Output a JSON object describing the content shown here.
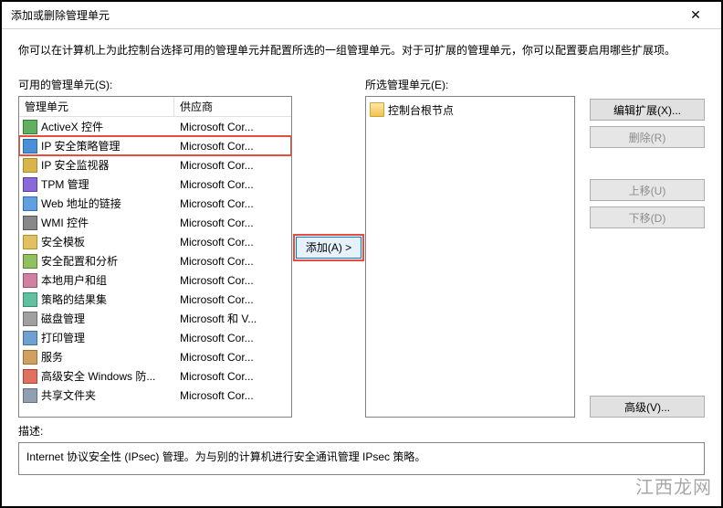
{
  "window": {
    "title": "添加或删除管理单元",
    "close_glyph": "✕"
  },
  "instructions": "你可以在计算机上为此控制台选择可用的管理单元并配置所选的一组管理单元。对于可扩展的管理单元，你可以配置要启用哪些扩展项。",
  "available": {
    "label": "可用的管理单元(S):",
    "columns": {
      "name": "管理单元",
      "vendor": "供应商"
    },
    "items": [
      {
        "name": "ActiveX 控件",
        "vendor": "Microsoft Cor...",
        "icon": "ico-activex",
        "selected": false
      },
      {
        "name": "IP 安全策略管理",
        "vendor": "Microsoft Cor...",
        "icon": "ico-ip",
        "selected": true
      },
      {
        "name": "IP 安全监视器",
        "vendor": "Microsoft Cor...",
        "icon": "ico-monitor",
        "selected": false
      },
      {
        "name": "TPM 管理",
        "vendor": "Microsoft Cor...",
        "icon": "ico-tpm",
        "selected": false
      },
      {
        "name": "Web 地址的链接",
        "vendor": "Microsoft Cor...",
        "icon": "ico-web",
        "selected": false
      },
      {
        "name": "WMI 控件",
        "vendor": "Microsoft Cor...",
        "icon": "ico-wmi",
        "selected": false
      },
      {
        "name": "安全模板",
        "vendor": "Microsoft Cor...",
        "icon": "ico-template",
        "selected": false
      },
      {
        "name": "安全配置和分析",
        "vendor": "Microsoft Cor...",
        "icon": "ico-config",
        "selected": false
      },
      {
        "name": "本地用户和组",
        "vendor": "Microsoft Cor...",
        "icon": "ico-users",
        "selected": false
      },
      {
        "name": "策略的结果集",
        "vendor": "Microsoft Cor...",
        "icon": "ico-policy",
        "selected": false
      },
      {
        "name": "磁盘管理",
        "vendor": "Microsoft 和 V...",
        "icon": "ico-disk",
        "selected": false
      },
      {
        "name": "打印管理",
        "vendor": "Microsoft Cor...",
        "icon": "ico-print",
        "selected": false
      },
      {
        "name": "服务",
        "vendor": "Microsoft Cor...",
        "icon": "ico-service",
        "selected": false
      },
      {
        "name": "高级安全 Windows 防...",
        "vendor": "Microsoft Cor...",
        "icon": "ico-firewall",
        "selected": false
      },
      {
        "name": "共享文件夹",
        "vendor": "Microsoft Cor...",
        "icon": "ico-share",
        "selected": false
      }
    ]
  },
  "add_button": "添加(A) >",
  "selected": {
    "label": "所选管理单元(E):",
    "root": "控制台根节点"
  },
  "side_buttons": {
    "edit_ext": "编辑扩展(X)...",
    "remove": "删除(R)",
    "move_up": "上移(U)",
    "move_down": "下移(D)",
    "advanced": "高级(V)..."
  },
  "description": {
    "label": "描述:",
    "text": "Internet 协议安全性 (IPsec) 管理。为与别的计算机进行安全通讯管理 IPsec 策略。"
  },
  "watermark": "江西龙网"
}
